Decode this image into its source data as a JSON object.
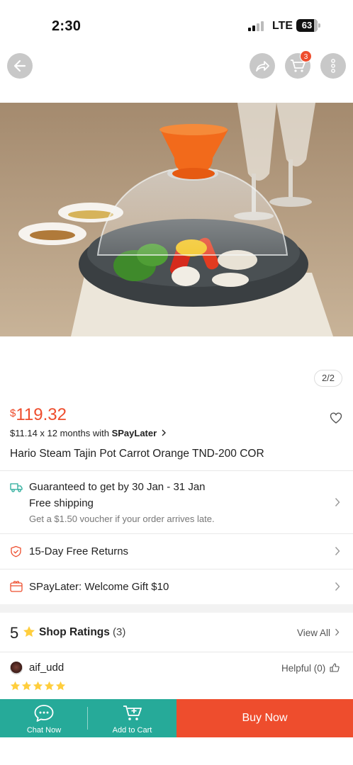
{
  "status_bar": {
    "time": "2:30",
    "network": "LTE",
    "battery": "63"
  },
  "nav": {
    "cart_count": "3"
  },
  "gallery": {
    "counter": "2/2"
  },
  "product": {
    "currency": "$",
    "price": "119.32",
    "installment_prefix": "$11.14 x 12 months with ",
    "installment_brand": "SPayLater",
    "title": "Hario Steam Tajin Pot Carrot Orange TND-200 COR"
  },
  "shipping": {
    "guarantee": "Guaranteed to get by 30 Jan - 31 Jan",
    "free": "Free shipping",
    "voucher": "Get a $1.50 voucher if your order arrives late."
  },
  "returns": {
    "label": "15-Day Free Returns"
  },
  "spaylater": {
    "label": "SPayLater: Welcome Gift $10"
  },
  "ratings": {
    "score": "5",
    "title": "Shop Ratings",
    "count": "(3)",
    "view_all": "View All"
  },
  "review": {
    "user": "aif_udd",
    "helpful": "Helpful (0)",
    "stars": 5
  },
  "bottom_bar": {
    "chat": "Chat Now",
    "add_to_cart": "Add to Cart",
    "buy_now": "Buy Now"
  },
  "colors": {
    "brand": "#ee4d2d",
    "teal": "#26aa99",
    "star": "#ffce3d"
  }
}
